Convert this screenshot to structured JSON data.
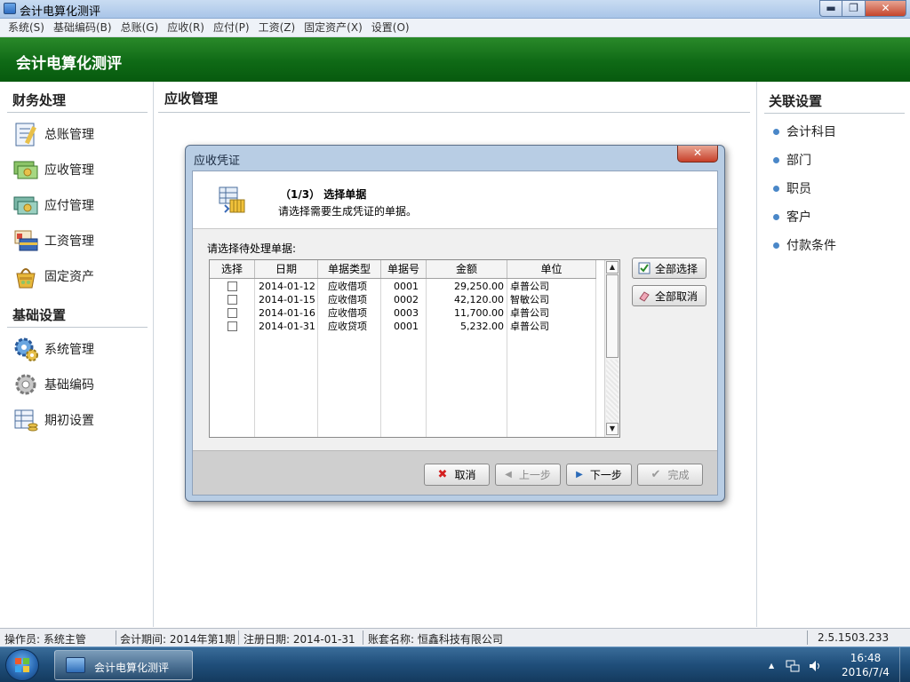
{
  "window": {
    "title": "会计电算化测评",
    "min_glyph": "▬",
    "max_glyph": "❐",
    "close_glyph": "✕"
  },
  "menu": [
    {
      "label": "系统(S)"
    },
    {
      "label": "基础编码(B)"
    },
    {
      "label": "总账(G)"
    },
    {
      "label": "应收(R)"
    },
    {
      "label": "应付(P)"
    },
    {
      "label": "工资(Z)"
    },
    {
      "label": "固定资产(X)"
    },
    {
      "label": "设置(O)"
    }
  ],
  "banner": {
    "title": "会计电算化测评"
  },
  "left_panel": {
    "finance": {
      "title": "财务处理",
      "items": [
        {
          "label": "总账管理",
          "icon": "ledger-icon"
        },
        {
          "label": "应收管理",
          "icon": "receivable-icon"
        },
        {
          "label": "应付管理",
          "icon": "payable-icon"
        },
        {
          "label": "工资管理",
          "icon": "payroll-icon"
        },
        {
          "label": "固定资产",
          "icon": "fixed-asset-icon"
        }
      ]
    },
    "basic": {
      "title": "基础设置",
      "items": [
        {
          "label": "系统管理",
          "icon": "system-gear-icon"
        },
        {
          "label": "基础编码",
          "icon": "basic-code-gear-icon"
        },
        {
          "label": "期初设置",
          "icon": "opening-setup-icon"
        }
      ]
    }
  },
  "center": {
    "title": "应收管理"
  },
  "right_panel": {
    "title": "关联设置",
    "items": [
      {
        "label": "会计科目"
      },
      {
        "label": "部门"
      },
      {
        "label": "职员"
      },
      {
        "label": "客户"
      },
      {
        "label": "付款条件"
      }
    ]
  },
  "dialog": {
    "title": "应收凭证",
    "close_glyph": "✕",
    "step": "（1/3）  选择单据",
    "description": "请选择需要生成凭证的单据。",
    "prompt": "请选择待处理单据:",
    "columns": [
      "选择",
      "日期",
      "单据类型",
      "单据号",
      "金额",
      "单位"
    ],
    "rows": [
      {
        "date": "2014-01-12",
        "type": "应收借项",
        "no": "0001",
        "amount": "29,250.00",
        "unit": "卓普公司",
        "checked": false
      },
      {
        "date": "2014-01-15",
        "type": "应收借项",
        "no": "0002",
        "amount": "42,120.00",
        "unit": "智敏公司",
        "checked": false
      },
      {
        "date": "2014-01-16",
        "type": "应收借项",
        "no": "0003",
        "amount": "11,700.00",
        "unit": "卓普公司",
        "checked": false
      },
      {
        "date": "2014-01-31",
        "type": "应收贷项",
        "no": "0001",
        "amount": "5,232.00",
        "unit": "卓普公司",
        "checked": false
      }
    ],
    "scroll_up_glyph": "▲",
    "scroll_down_glyph": "▼",
    "select_all": "全部选择",
    "deselect_all": "全部取消",
    "cancel": "取消",
    "cancel_glyph": "✖",
    "prev": "上一步",
    "prev_glyph": "◀",
    "next": "下一步",
    "next_glyph": "▶",
    "finish": "完成",
    "finish_glyph": "✔"
  },
  "status": {
    "operator": "操作员: 系统主管",
    "period": "会计期间: 2014年第1期",
    "register_date": "注册日期: 2014-01-31",
    "account": "账套名称: 恒鑫科技有限公司",
    "version": "2.5.1503.233"
  },
  "taskbar": {
    "app_label": "会计电算化测评",
    "tray_up": "▲",
    "time": "16:48",
    "date": "2016/7/4"
  },
  "colors": {
    "banner": "#0f6a16",
    "dialog_frame": "#b8cde4",
    "bullet": "#4a87c8",
    "cancel_red": "#d42020"
  }
}
